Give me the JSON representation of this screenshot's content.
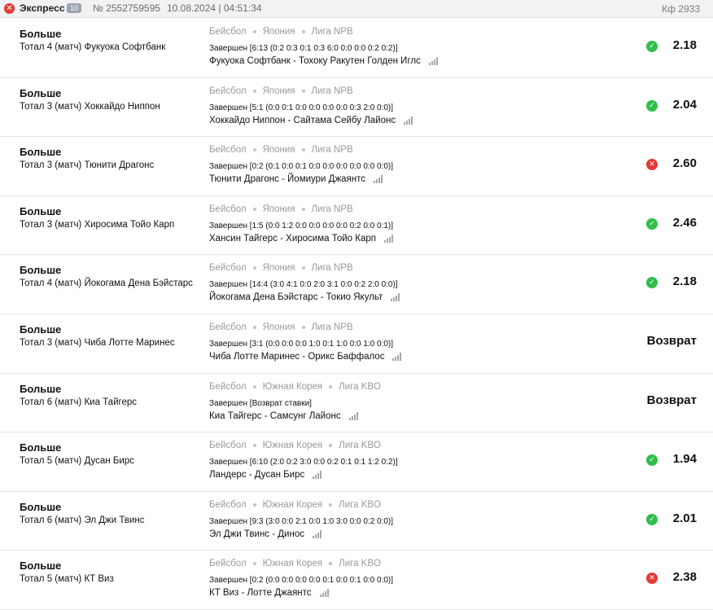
{
  "header": {
    "status_icon": "close-icon",
    "type_label": "Экспресс",
    "events_count": "10",
    "number": "№ 2552759595",
    "datetime": "10.08.2024 | 04:51:34",
    "coef": "Кф 2933"
  },
  "colors": {
    "win": "#2fbf4a",
    "lose": "#e53935",
    "header_bg": "#f2f2f2"
  },
  "bets": [
    {
      "type": "Больше",
      "detail": "Тотал 4 (матч) Фукуока Софтбанк",
      "sport": "Бейсбол",
      "country": "Япония",
      "league": "Лига NPB",
      "status": "Завершен [6:13 (0:2 0:3 0:1 0:3 6:0 0:0 0:0 0:2 0:2)]",
      "match": "Фукуока Софтбанк - Тохоку Ракутен Голден Иглс",
      "result": "win",
      "result_icon": "check-icon",
      "coef": "2.18"
    },
    {
      "type": "Больше",
      "detail": "Тотал 3 (матч) Хоккайдо Ниппон",
      "sport": "Бейсбол",
      "country": "Япония",
      "league": "Лига NPB",
      "status": "Завершен [5:1 (0:0 0:1 0:0 0:0 0:0 0:0 0:3 2:0 0:0)]",
      "match": "Хоккайдо Ниппон - Сайтама Сейбу Лайонс",
      "result": "win",
      "result_icon": "check-icon",
      "coef": "2.04"
    },
    {
      "type": "Больше",
      "detail": "Тотал 3 (матч) Тюнити Драгонс",
      "sport": "Бейсбол",
      "country": "Япония",
      "league": "Лига NPB",
      "status": "Завершен [0:2 (0:1 0:0 0:1 0:0 0:0 0:0 0:0 0:0 0:0)]",
      "match": "Тюнити Драгонс - Йомиури Джаянтс",
      "result": "lose",
      "result_icon": "cross-icon",
      "coef": "2.60"
    },
    {
      "type": "Больше",
      "detail": "Тотал 3 (матч) Хиросима Тойо Карп",
      "sport": "Бейсбол",
      "country": "Япония",
      "league": "Лига NPB",
      "status": "Завершен [1:5 (0:0 1:2 0:0 0:0 0:0 0:0 0:2 0:0 0:1)]",
      "match": "Хансин Тайгерс - Хиросима Тойо Карп",
      "result": "win",
      "result_icon": "check-icon",
      "coef": "2.46"
    },
    {
      "type": "Больше",
      "detail": "Тотал 4 (матч) Йокогама Дена Бэйстарс",
      "sport": "Бейсбол",
      "country": "Япония",
      "league": "Лига NPB",
      "status": "Завершен [14:4 (3:0 4:1 0:0 2:0 3:1 0:0 0:2 2:0 0:0)]",
      "match": "Йокогама Дена Бэйстарс - Токио Якульт",
      "result": "win",
      "result_icon": "check-icon",
      "coef": "2.18"
    },
    {
      "type": "Больше",
      "detail": "Тотал 3 (матч) Чиба Лотте Маринес",
      "sport": "Бейсбол",
      "country": "Япония",
      "league": "Лига NPB",
      "status": "Завершен [3:1 (0:0 0:0 0:0 1:0 0:1 1:0 0:0 1:0 0:0)]",
      "match": "Чиба Лотте Маринес - Орикс Баффалос",
      "result": "refund",
      "result_icon": "",
      "coef": "Возврат"
    },
    {
      "type": "Больше",
      "detail": "Тотал 6 (матч) Киа Тайгерс",
      "sport": "Бейсбол",
      "country": "Южная Корея",
      "league": "Лига KBO",
      "status": "Завершен [Возврат ставки]",
      "match": "Киа Тайгерс - Самсунг Лайонс",
      "result": "refund",
      "result_icon": "",
      "coef": "Возврат"
    },
    {
      "type": "Больше",
      "detail": "Тотал 5 (матч) Дусан Бирс",
      "sport": "Бейсбол",
      "country": "Южная Корея",
      "league": "Лига KBO",
      "status": "Завершен [6:10 (2:0 0:2 3:0 0:0 0:2 0:1 0:1 1:2 0:2)]",
      "match": "Ландерс - Дусан Бирс",
      "result": "win",
      "result_icon": "check-icon",
      "coef": "1.94"
    },
    {
      "type": "Больше",
      "detail": "Тотал 6 (матч) Эл Джи Твинс",
      "sport": "Бейсбол",
      "country": "Южная Корея",
      "league": "Лига KBO",
      "status": "Завершен [9:3 (3:0 0:0 2:1 0:0 1:0 3:0 0:0 0:2 0:0)]",
      "match": "Эл Джи Твинс - Динос",
      "result": "win",
      "result_icon": "check-icon",
      "coef": "2.01"
    },
    {
      "type": "Больше",
      "detail": "Тотал 5 (матч) КТ Виз",
      "sport": "Бейсбол",
      "country": "Южная Корея",
      "league": "Лига KBO",
      "status": "Завершен [0:2 (0:0 0:0 0:0 0:0 0:1 0:0 0:1 0:0 0:0)]",
      "match": "КТ Виз - Лотте Джаянтс",
      "result": "lose",
      "result_icon": "cross-icon",
      "coef": "2.38"
    }
  ]
}
